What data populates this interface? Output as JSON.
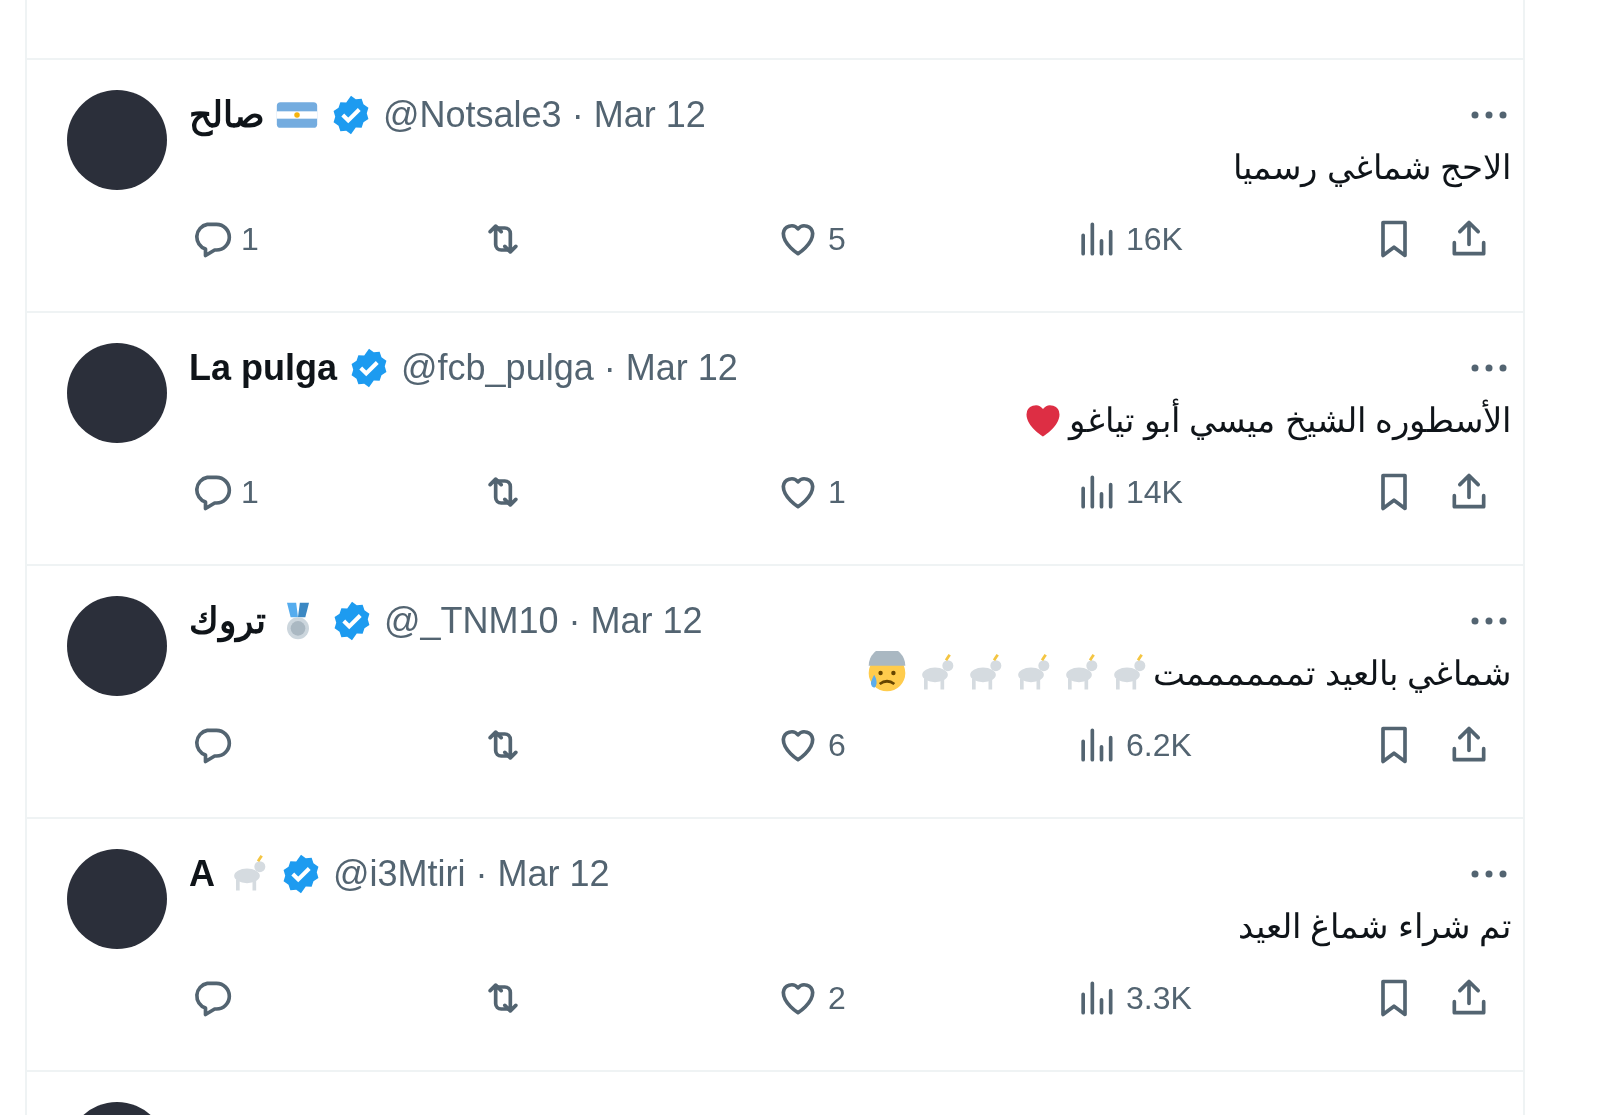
{
  "replies": [
    {
      "name": "صالح",
      "name_icon": {
        "kind": "flag"
      },
      "verified": true,
      "handle": "@Notsale3",
      "separator": "·",
      "date": "Mar 12",
      "text": "الاحج شماغي رسميا",
      "stats": {
        "replies": "1",
        "likes": "5",
        "views": "16K"
      }
    },
    {
      "name": "La pulga",
      "verified": true,
      "handle": "@fcb_pulga",
      "separator": "·",
      "date": "Mar 12",
      "text": "الأسطوره الشيخ ميسي أبو تياغو",
      "text_icons": [
        {
          "kind": "heart"
        }
      ],
      "stats": {
        "replies": "1",
        "likes": "1",
        "views": "14K"
      }
    },
    {
      "name": "تروك",
      "name_icon": {
        "kind": "medal"
      },
      "verified": true,
      "handle": "@_TNM10",
      "separator": "·",
      "date": "Mar 12",
      "text": "شماغي بالعيد تممممممت",
      "text_icons": [
        {
          "kind": "goat"
        },
        {
          "kind": "goat"
        },
        {
          "kind": "goat"
        },
        {
          "kind": "goat"
        },
        {
          "kind": "goat"
        },
        {
          "kind": "face"
        }
      ],
      "stats": {
        "likes": "6",
        "views": "6.2K"
      }
    },
    {
      "name": "A",
      "name_icon": {
        "kind": "goat"
      },
      "verified": true,
      "handle": "@i3Mtiri",
      "separator": "·",
      "date": "Mar 12",
      "text": "تم شراء شماغ العيد",
      "stats": {
        "likes": "2",
        "views": "3.3K"
      }
    }
  ]
}
